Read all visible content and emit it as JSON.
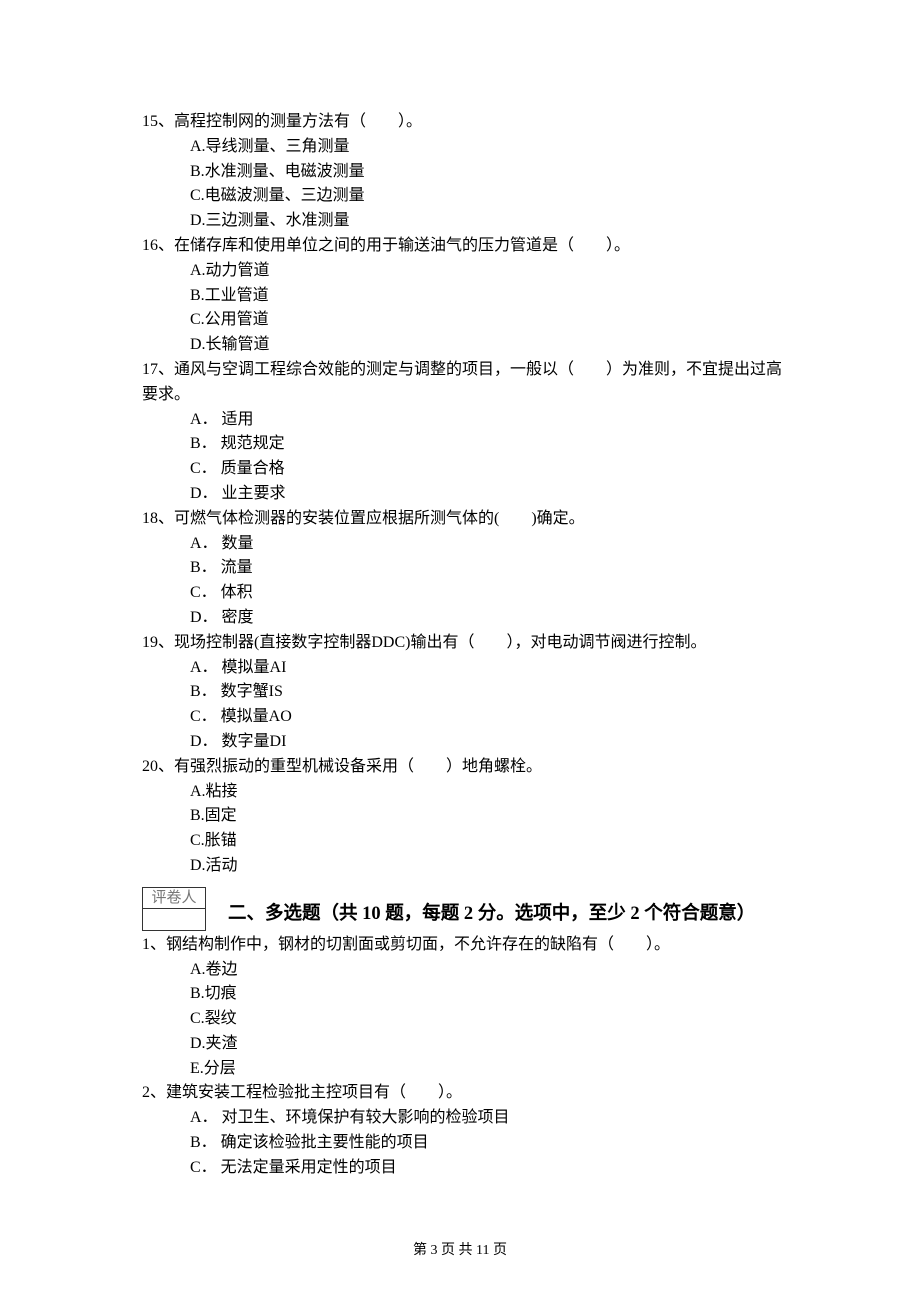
{
  "questions_part1": [
    {
      "num": "15",
      "stem": "、高程控制网的测量方法有（　　）。",
      "options": [
        "A.导线测量、三角测量",
        "B.水准测量、电磁波测量",
        "C.电磁波测量、三边测量",
        "D.三边测量、水准测量"
      ]
    },
    {
      "num": "16",
      "stem": "、在储存库和使用单位之间的用于输送油气的压力管道是（　　）。",
      "options": [
        "A.动力管道",
        "B.工业管道",
        "C.公用管道",
        "D.长输管道"
      ]
    },
    {
      "num": "17",
      "stem": "、通风与空调工程综合效能的测定与调整的项目，一般以（　　）为准则，不宜提出过高要求。",
      "stem2": "",
      "options": [
        "A． 适用",
        "B． 规范规定",
        "C． 质量合格",
        "D． 业主要求"
      ]
    },
    {
      "num": "18",
      "stem": "、可燃气体检测器的安装位置应根据所测气体的(　　)确定。",
      "options": [
        "A． 数量",
        "B． 流量",
        "C． 体积",
        "D． 密度"
      ]
    },
    {
      "num": "19",
      "stem": "、现场控制器(直接数字控制器DDC)输出有（　　），对电动调节阀进行控制。",
      "options": [
        "A． 模拟量AI",
        "B． 数字蟹IS",
        "C． 模拟量AO",
        "D． 数字量DI"
      ]
    },
    {
      "num": "20",
      "stem": "、有强烈振动的重型机械设备采用（　　）地角螺栓。",
      "options": [
        "A.粘接",
        "B.固定",
        "C.胀锚",
        "D.活动"
      ]
    }
  ],
  "grader_label": "评卷人",
  "section2_title": "二、多选题（共 10 题，每题 2 分。选项中，至少 2 个符合题意）",
  "questions_part2": [
    {
      "num": "1",
      "stem": "、钢结构制作中，钢材的切割面或剪切面，不允许存在的缺陷有（　　）。",
      "options": [
        "A.卷边",
        "B.切痕",
        "C.裂纹",
        "D.夹渣",
        "E.分层"
      ]
    },
    {
      "num": "2",
      "stem": "、建筑安装工程检验批主控项目有（　　）。",
      "options": [
        "A． 对卫生、环境保护有较大影响的检验项目",
        "B． 确定该检验批主要性能的项目",
        "C． 无法定量采用定性的项目"
      ]
    }
  ],
  "footer": "第 3 页 共 11 页"
}
